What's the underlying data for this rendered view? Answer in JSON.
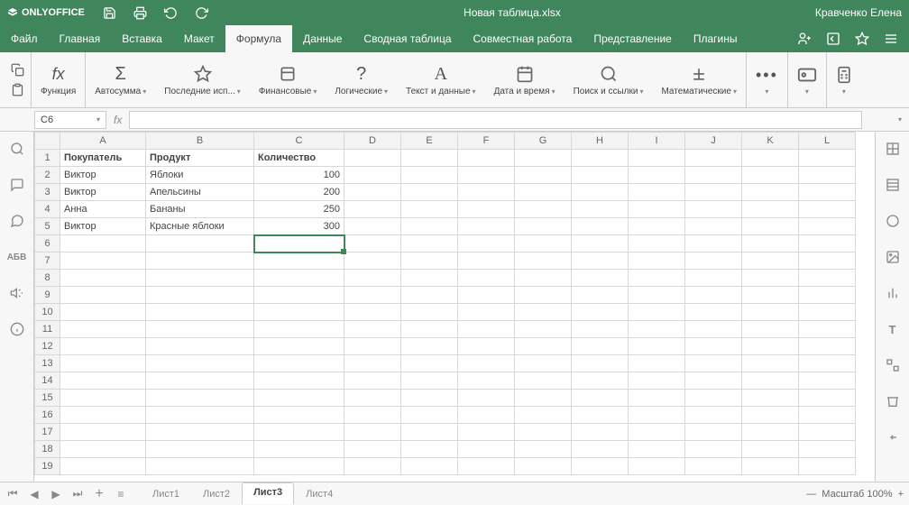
{
  "app": {
    "name": "ONLYOFFICE",
    "title": "Новая таблица.xlsx",
    "user": "Кравченко Елена"
  },
  "menu": {
    "file": "Файл",
    "home": "Главная",
    "insert": "Вставка",
    "layout": "Макет",
    "formula": "Формула",
    "data": "Данные",
    "pivot": "Сводная таблица",
    "collab": "Совместная работа",
    "view": "Представление",
    "plugins": "Плагины"
  },
  "ribbon": {
    "function": "Функция",
    "autosum": "Автосумма",
    "recent": "Последние исп...",
    "financial": "Финансовые",
    "logical": "Логические",
    "text": "Текст и данные",
    "datetime": "Дата и время",
    "lookup": "Поиск и ссылки",
    "math": "Математические",
    "more": "",
    "named": "",
    "calc": ""
  },
  "namebox": "C6",
  "sheet": {
    "columns": [
      "A",
      "B",
      "C",
      "D",
      "E",
      "F",
      "G",
      "H",
      "I",
      "J",
      "K",
      "L"
    ],
    "headers": {
      "buyer": "Покупатель",
      "product": "Продукт",
      "qty": "Количество"
    },
    "rows": [
      {
        "buyer": "Виктор",
        "product": "Яблоки",
        "qty": "100"
      },
      {
        "buyer": "Виктор",
        "product": "Апельсины",
        "qty": "200"
      },
      {
        "buyer": "Анна",
        "product": "Бананы",
        "qty": "250"
      },
      {
        "buyer": "Виктор",
        "product": "Красные яблоки",
        "qty": "300"
      }
    ]
  },
  "tabs": {
    "s1": "Лист1",
    "s2": "Лист2",
    "s3": "Лист3",
    "s4": "Лист4"
  },
  "status": {
    "zoom": "Масштаб 100%",
    "minus": "—",
    "plus": "+"
  }
}
